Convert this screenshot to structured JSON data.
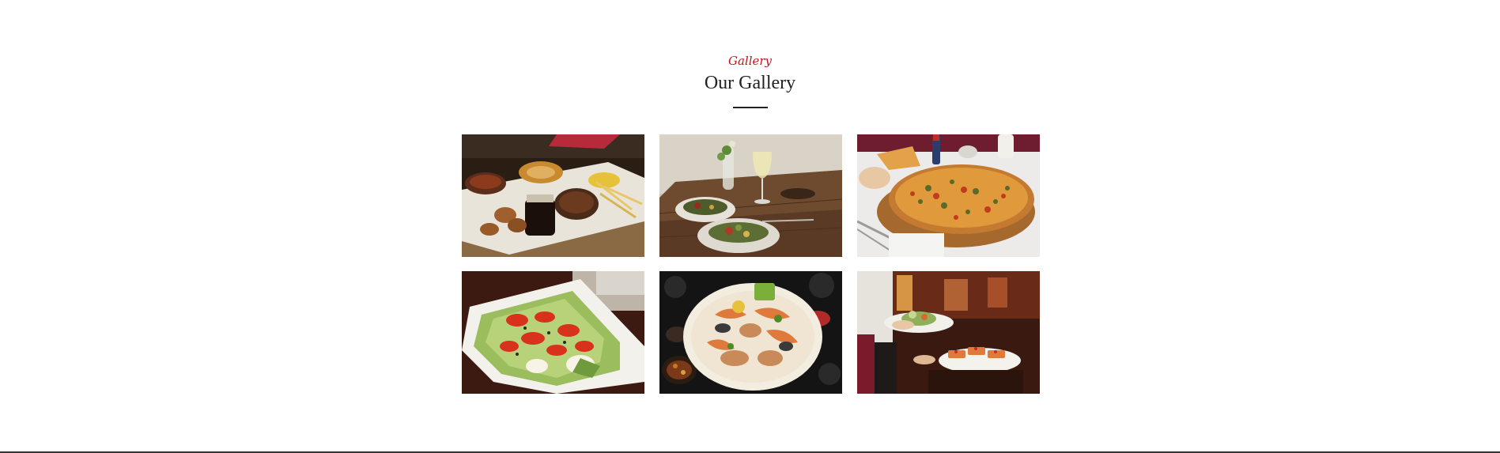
{
  "section": {
    "eyebrow": "Gallery",
    "title": "Our Gallery"
  },
  "colors": {
    "accent": "#c0141c",
    "heading": "#222222",
    "divider": "#222222"
  },
  "gallery": {
    "images": [
      {
        "name": "gallery-image-steak-platter",
        "subject": "steak-platter"
      },
      {
        "name": "gallery-image-salad-bowls-wine",
        "subject": "salad-bowls-wine"
      },
      {
        "name": "gallery-image-pizza",
        "subject": "pizza"
      },
      {
        "name": "gallery-image-fresh-salad",
        "subject": "fresh-salad"
      },
      {
        "name": "gallery-image-seafood-platter",
        "subject": "seafood-platter"
      },
      {
        "name": "gallery-image-waiter-serving",
        "subject": "waiter-serving"
      }
    ]
  }
}
